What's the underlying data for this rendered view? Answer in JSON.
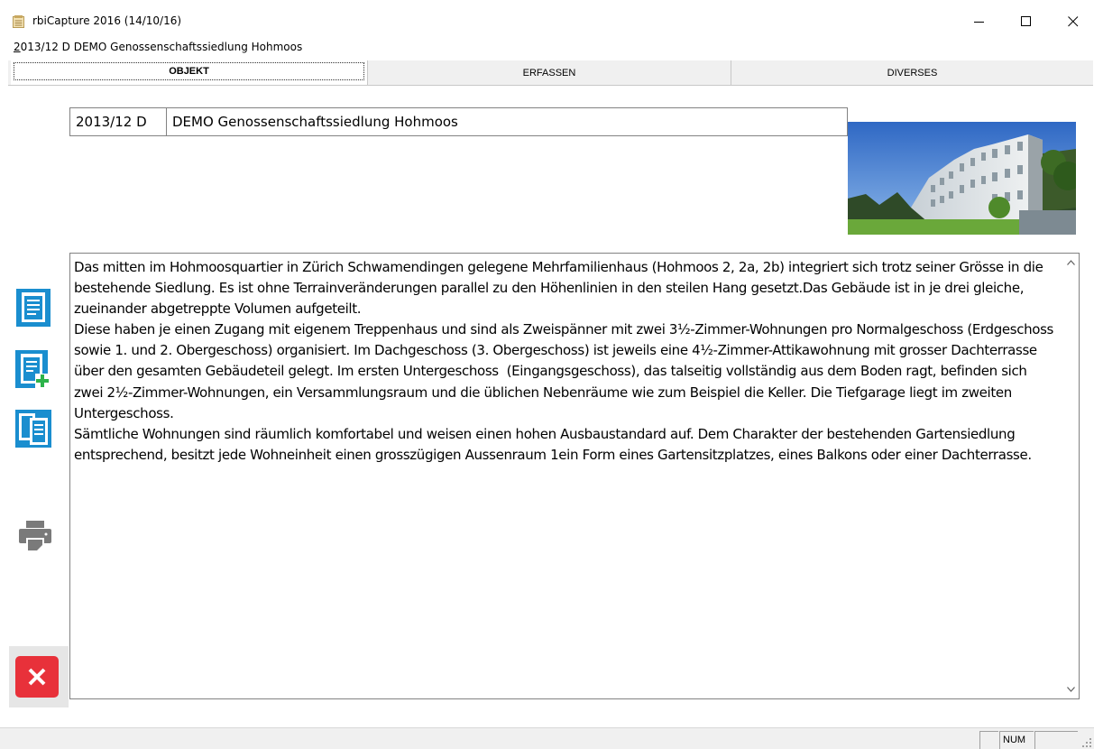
{
  "window": {
    "title": "rbiCapture 2016 (14/10/16)",
    "subtitle_accel": "2",
    "subtitle_rest": "013/12 D DEMO Genossenschaftssiedlung Hohmoos"
  },
  "tabs": [
    {
      "label": "OBJEKT",
      "active": true
    },
    {
      "label": "ERFASSEN",
      "active": false
    },
    {
      "label": "DIVERSES",
      "active": false
    }
  ],
  "object": {
    "code": "2013/12 D",
    "name": "DEMO Genossenschaftssiedlung Hohmoos"
  },
  "description": "Das mitten im Hohmoosquartier in Zürich Schwamendingen gelegene Mehrfamilienhaus (Hohmoos 2, 2a, 2b) integriert sich trotz seiner Grösse in die bestehende Siedlung. Es ist ohne Terrainveränderungen parallel zu den Höhenlinien in den steilen Hang gesetzt.Das Gebäude ist in je drei gleiche, zueinander abgetreppte Volumen aufgeteilt.\nDiese haben je einen Zugang mit eigenem Treppenhaus und sind als Zweispänner mit zwei 3½-Zimmer-Wohnungen pro Normalgeschoss (Erdgeschoss sowie 1. und 2. Obergeschoss) organisiert. Im Dachgeschoss (3. Obergeschoss) ist jeweils eine 4½-Zimmer-Attikawohnung mit grosser Dachterrasse über den gesamten Gebäudeteil gelegt. Im ersten Untergeschoss  (Eingangsgeschoss), das talseitig vollständig aus dem Boden ragt, befinden sich zwei 2½-Zimmer-Wohnungen, ein Versammlungsraum und die üblichen Nebenräume wie zum Beispiel die Keller. Die Tiefgarage liegt im zweiten Untergeschoss.\nSämtliche Wohnungen sind räumlich komfortabel und weisen einen hohen Ausbaustandard auf. Dem Charakter der bestehenden Gartensiedlung entsprechend, besitzt jede Wohneinheit einen grosszügigen Aussenraum 1ein Form eines Gartensitzplatzes, eines Balkons oder einer Dachterrasse.",
  "sidebar": {
    "icons": [
      "document-icon",
      "new-document-icon",
      "copy-document-icon",
      "printer-icon",
      "close-icon"
    ]
  },
  "statusbar": {
    "num": "NUM"
  },
  "colors": {
    "accent": "#1a8ecf",
    "close_red": "#e8313a",
    "printer_gray": "#7a7a7a"
  }
}
